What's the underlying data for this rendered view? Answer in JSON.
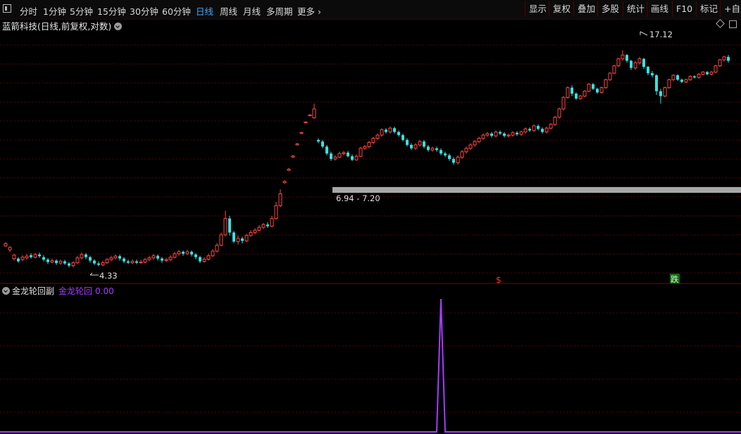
{
  "toolbar": {
    "tabs": [
      "分时",
      "1分钟",
      "5分钟",
      "15分钟",
      "30分钟",
      "60分钟",
      "日线",
      "周线",
      "月线",
      "多周期",
      "更多"
    ],
    "active_tab": "日线",
    "right_buttons": [
      "显示",
      "复权",
      "叠加",
      "多股",
      "统计",
      "画线",
      "F10",
      "标记",
      "+自选"
    ]
  },
  "main_chart": {
    "title": "蓝箭科技(日线,前复权,对数)",
    "high_label": "17.12",
    "low_label": "4.33",
    "range_label": "6.94 - 7.20",
    "signal_sell": "$",
    "signal_fall": "跌",
    "colors": {
      "up": "#ff4444",
      "down": "#39e0e0",
      "band": "#a8a8a8",
      "grid": "#5a0000"
    }
  },
  "sub_chart": {
    "title": "金龙轮回副",
    "series_name": "金龙轮回",
    "value": "0.00",
    "color": "#a43cff"
  },
  "chart_data": {
    "type": "candlestick",
    "log_scale": true,
    "y_range": [
      4.0,
      19.5
    ],
    "band": [
      6.94,
      7.2
    ],
    "annotations": [
      {
        "text": "17.12",
        "value": 17.12
      },
      {
        "text": "4.33",
        "value": 4.33
      }
    ],
    "candles": [
      [
        4.96,
        5.03,
        4.93,
        5.08
      ],
      [
        4.84,
        4.91,
        4.78,
        4.96
      ],
      [
        4.58,
        4.68,
        4.52,
        4.72
      ],
      [
        4.58,
        4.5,
        4.46,
        4.62
      ],
      [
        4.55,
        4.62,
        4.5,
        4.68
      ],
      [
        4.6,
        4.65,
        4.55,
        4.72
      ],
      [
        4.68,
        4.62,
        4.58,
        4.74
      ],
      [
        4.62,
        4.7,
        4.58,
        4.75
      ],
      [
        4.7,
        4.65,
        4.6,
        4.76
      ],
      [
        4.62,
        4.55,
        4.5,
        4.68
      ],
      [
        4.55,
        4.48,
        4.42,
        4.6
      ],
      [
        4.48,
        4.52,
        4.44,
        4.58
      ],
      [
        4.52,
        4.45,
        4.4,
        4.56
      ],
      [
        4.45,
        4.5,
        4.4,
        4.55
      ],
      [
        4.5,
        4.44,
        4.4,
        4.54
      ],
      [
        4.44,
        4.38,
        4.33,
        4.48
      ],
      [
        4.38,
        4.46,
        4.33,
        4.5
      ],
      [
        4.46,
        4.6,
        4.42,
        4.66
      ],
      [
        4.6,
        4.7,
        4.55,
        4.76
      ],
      [
        4.7,
        4.62,
        4.56,
        4.74
      ],
      [
        4.62,
        4.52,
        4.46,
        4.66
      ],
      [
        4.52,
        4.44,
        4.4,
        4.56
      ],
      [
        4.44,
        4.4,
        4.36,
        4.5
      ],
      [
        4.4,
        4.46,
        4.36,
        4.52
      ],
      [
        4.46,
        4.55,
        4.42,
        4.6
      ],
      [
        4.55,
        4.6,
        4.5,
        4.66
      ],
      [
        4.6,
        4.65,
        4.56,
        4.7
      ],
      [
        4.65,
        4.58,
        4.52,
        4.7
      ],
      [
        4.58,
        4.5,
        4.45,
        4.62
      ],
      [
        4.5,
        4.46,
        4.42,
        4.55
      ],
      [
        4.46,
        4.5,
        4.42,
        4.56
      ],
      [
        4.5,
        4.46,
        4.42,
        4.55
      ],
      [
        4.46,
        4.48,
        4.42,
        4.54
      ],
      [
        4.48,
        4.55,
        4.44,
        4.6
      ],
      [
        4.55,
        4.6,
        4.5,
        4.66
      ],
      [
        4.6,
        4.66,
        4.55,
        4.72
      ],
      [
        4.66,
        4.58,
        4.52,
        4.7
      ],
      [
        4.58,
        4.52,
        4.46,
        4.62
      ],
      [
        4.52,
        4.55,
        4.48,
        4.6
      ],
      [
        4.55,
        4.62,
        4.5,
        4.68
      ],
      [
        4.62,
        4.72,
        4.58,
        4.78
      ],
      [
        4.72,
        4.78,
        4.66,
        4.84
      ],
      [
        4.78,
        4.72,
        4.66,
        4.82
      ],
      [
        4.72,
        4.78,
        4.68,
        4.84
      ],
      [
        4.78,
        4.7,
        4.64,
        4.82
      ],
      [
        4.7,
        4.62,
        4.56,
        4.74
      ],
      [
        4.62,
        4.5,
        4.45,
        4.66
      ],
      [
        4.5,
        4.56,
        4.46,
        4.62
      ],
      [
        4.56,
        4.66,
        4.52,
        4.72
      ],
      [
        4.66,
        4.8,
        4.62,
        4.86
      ],
      [
        4.8,
        4.98,
        4.76,
        5.05
      ],
      [
        4.98,
        5.32,
        4.95,
        5.4
      ],
      [
        5.32,
        5.9,
        5.28,
        6.2
      ],
      [
        5.9,
        5.4,
        5.3,
        6.0
      ],
      [
        5.4,
        5.1,
        5.05,
        5.45
      ],
      [
        5.1,
        5.2,
        5.0,
        5.3
      ],
      [
        5.2,
        5.12,
        5.04,
        5.26
      ],
      [
        5.12,
        5.3,
        5.08,
        5.36
      ],
      [
        5.3,
        5.4,
        5.26,
        5.48
      ],
      [
        5.4,
        5.48,
        5.34,
        5.55
      ],
      [
        5.48,
        5.58,
        5.44,
        5.66
      ],
      [
        5.58,
        5.68,
        5.52,
        5.74
      ],
      [
        5.68,
        5.62,
        5.56,
        5.76
      ],
      [
        5.62,
        5.9,
        5.58,
        6.0
      ],
      [
        5.9,
        6.4,
        5.86,
        6.55
      ],
      [
        6.4,
        6.9,
        6.34,
        7.1
      ],
      [
        7.4,
        7.46,
        7.36,
        7.52
      ],
      [
        8.0,
        8.06,
        7.96,
        8.12
      ],
      [
        8.7,
        8.76,
        8.66,
        8.82
      ],
      [
        9.4,
        9.46,
        9.36,
        9.52
      ],
      [
        10.1,
        10.16,
        10.06,
        10.22
      ],
      [
        10.8,
        10.86,
        10.76,
        10.92
      ],
      [
        11.3,
        11.36,
        11.26,
        11.42
      ],
      [
        11.15,
        11.8,
        11.1,
        12.2
      ],
      [
        9.7,
        9.6,
        9.5,
        9.8
      ],
      [
        9.6,
        9.3,
        9.2,
        9.7
      ],
      [
        9.3,
        8.9,
        8.8,
        9.4
      ],
      [
        8.9,
        8.6,
        8.5,
        9.0
      ],
      [
        8.6,
        8.7,
        8.52,
        8.8
      ],
      [
        8.7,
        8.9,
        8.64,
        9.0
      ],
      [
        8.9,
        8.95,
        8.8,
        9.05
      ],
      [
        8.95,
        8.75,
        8.68,
        9.05
      ],
      [
        8.75,
        8.55,
        8.48,
        8.85
      ],
      [
        8.55,
        8.75,
        8.5,
        8.85
      ],
      [
        8.75,
        9.2,
        8.7,
        9.3
      ],
      [
        9.2,
        9.3,
        9.1,
        9.4
      ],
      [
        9.3,
        9.55,
        9.2,
        9.65
      ],
      [
        9.55,
        9.8,
        9.45,
        9.9
      ],
      [
        9.8,
        10.0,
        9.7,
        10.1
      ],
      [
        10.0,
        10.35,
        9.9,
        10.45
      ],
      [
        10.35,
        10.2,
        10.1,
        10.45
      ],
      [
        10.2,
        10.45,
        10.1,
        10.55
      ],
      [
        10.45,
        10.2,
        10.1,
        10.55
      ],
      [
        10.2,
        10.0,
        9.9,
        10.3
      ],
      [
        10.0,
        9.7,
        9.6,
        10.1
      ],
      [
        9.7,
        9.4,
        9.3,
        9.8
      ],
      [
        9.4,
        9.2,
        9.1,
        9.5
      ],
      [
        9.2,
        9.4,
        9.1,
        9.5
      ],
      [
        9.4,
        9.6,
        9.3,
        9.7
      ],
      [
        9.6,
        9.3,
        9.2,
        9.7
      ],
      [
        9.3,
        9.1,
        9.0,
        9.4
      ],
      [
        9.1,
        9.2,
        9.0,
        9.3
      ],
      [
        9.2,
        9.1,
        9.0,
        9.3
      ],
      [
        9.1,
        8.9,
        8.8,
        9.2
      ],
      [
        8.9,
        8.8,
        8.7,
        9.0
      ],
      [
        8.8,
        8.6,
        8.5,
        8.9
      ],
      [
        8.6,
        8.4,
        8.3,
        8.7
      ],
      [
        8.4,
        8.7,
        8.3,
        8.8
      ],
      [
        8.7,
        9.0,
        8.6,
        9.1
      ],
      [
        9.0,
        9.2,
        8.9,
        9.3
      ],
      [
        9.2,
        9.4,
        9.1,
        9.5
      ],
      [
        9.4,
        9.6,
        9.3,
        9.7
      ],
      [
        9.6,
        9.8,
        9.5,
        9.9
      ],
      [
        9.8,
        10.0,
        9.7,
        10.1
      ],
      [
        10.0,
        10.1,
        9.9,
        10.2
      ],
      [
        10.1,
        9.95,
        9.85,
        10.2
      ],
      [
        9.95,
        10.2,
        9.85,
        10.3
      ],
      [
        10.2,
        10.1,
        10.0,
        10.3
      ],
      [
        10.1,
        9.95,
        9.85,
        10.2
      ],
      [
        9.95,
        10.0,
        9.85,
        10.1
      ],
      [
        10.0,
        10.15,
        9.9,
        10.25
      ],
      [
        10.15,
        10.05,
        9.95,
        10.25
      ],
      [
        10.05,
        10.2,
        9.95,
        10.3
      ],
      [
        10.2,
        10.4,
        10.1,
        10.5
      ],
      [
        10.4,
        10.3,
        10.2,
        10.5
      ],
      [
        10.3,
        10.6,
        10.2,
        10.7
      ],
      [
        10.6,
        10.4,
        10.3,
        10.7
      ],
      [
        10.4,
        10.2,
        10.1,
        10.5
      ],
      [
        10.2,
        10.45,
        10.1,
        10.55
      ],
      [
        10.45,
        10.7,
        10.35,
        10.8
      ],
      [
        10.7,
        11.2,
        10.6,
        11.3
      ],
      [
        11.2,
        11.8,
        11.1,
        11.9
      ],
      [
        11.8,
        12.7,
        11.7,
        12.8
      ],
      [
        12.7,
        13.5,
        12.6,
        13.6
      ],
      [
        13.5,
        13.0,
        12.8,
        13.7
      ],
      [
        13.0,
        12.6,
        12.5,
        13.1
      ],
      [
        12.6,
        12.8,
        12.5,
        12.9
      ],
      [
        12.8,
        13.2,
        12.7,
        13.3
      ],
      [
        13.2,
        13.8,
        13.1,
        13.9
      ],
      [
        13.8,
        13.4,
        13.3,
        13.9
      ],
      [
        13.4,
        13.1,
        13.0,
        13.5
      ],
      [
        13.1,
        13.5,
        13.0,
        13.6
      ],
      [
        13.5,
        14.2,
        13.4,
        14.3
      ],
      [
        14.2,
        14.8,
        14.1,
        14.9
      ],
      [
        14.8,
        15.5,
        14.7,
        15.6
      ],
      [
        15.5,
        16.2,
        15.4,
        16.3
      ],
      [
        16.2,
        16.6,
        16.0,
        17.12
      ],
      [
        16.6,
        16.0,
        15.8,
        16.7
      ],
      [
        16.0,
        15.3,
        15.1,
        16.1
      ],
      [
        15.3,
        15.8,
        15.1,
        16.0
      ],
      [
        15.8,
        16.2,
        15.6,
        16.4
      ],
      [
        16.2,
        15.4,
        15.2,
        16.3
      ],
      [
        15.4,
        14.8,
        14.6,
        15.5
      ],
      [
        14.8,
        14.6,
        14.4,
        15.0
      ],
      [
        14.6,
        13.2,
        12.9,
        14.7
      ],
      [
        13.2,
        12.8,
        12.2,
        13.4
      ],
      [
        12.8,
        13.5,
        12.7,
        13.6
      ],
      [
        13.5,
        14.2,
        13.4,
        14.3
      ],
      [
        14.2,
        14.6,
        14.1,
        14.7
      ],
      [
        14.6,
        14.2,
        14.1,
        14.7
      ],
      [
        14.2,
        14.0,
        13.9,
        14.3
      ],
      [
        14.0,
        14.2,
        13.9,
        14.3
      ],
      [
        14.2,
        14.5,
        14.1,
        14.6
      ],
      [
        14.5,
        14.4,
        14.3,
        14.6
      ],
      [
        14.4,
        14.7,
        14.3,
        14.8
      ],
      [
        14.7,
        14.9,
        14.6,
        15.0
      ],
      [
        14.9,
        14.7,
        14.6,
        15.0
      ],
      [
        14.7,
        14.9,
        14.6,
        15.0
      ],
      [
        14.9,
        15.5,
        14.8,
        15.6
      ],
      [
        15.5,
        16.1,
        15.4,
        16.2
      ],
      [
        16.1,
        16.4,
        15.9,
        16.5
      ],
      [
        16.4,
        16.0,
        15.8,
        16.6
      ]
    ],
    "sub_series": {
      "name": "金龙轮回",
      "values_nonzero": [
        {
          "index": 103,
          "value": 1.0
        }
      ],
      "baseline": 0
    }
  }
}
